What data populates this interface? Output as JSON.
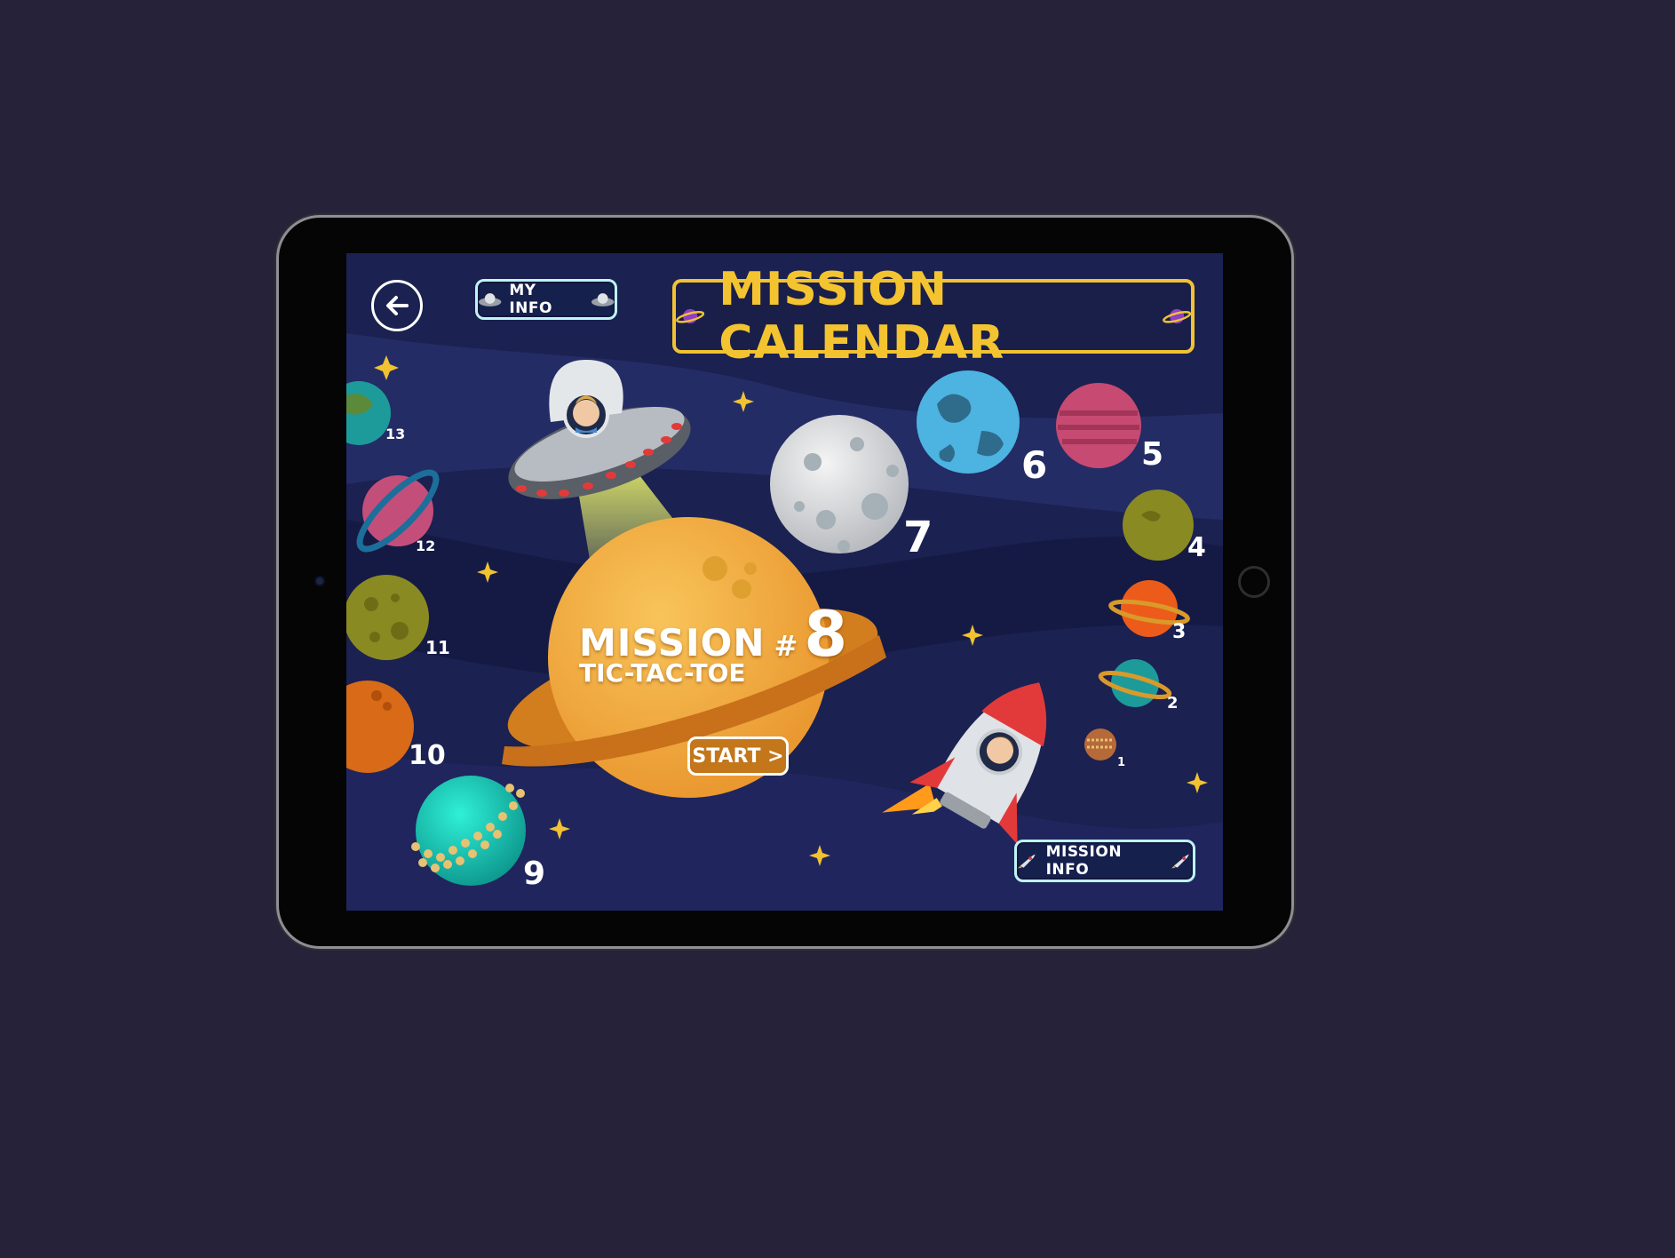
{
  "header": {
    "back_icon": "arrow-left-icon",
    "my_info_label": "MY INFO",
    "title": "MISSION CALENDAR"
  },
  "current_mission": {
    "label": "MISSION",
    "hash": "#",
    "number": "8",
    "name": "TIC-TAC-TOE",
    "start_label": "START >"
  },
  "mission_info_label": "MISSION INFO",
  "planets": [
    {
      "number": "1"
    },
    {
      "number": "2"
    },
    {
      "number": "3"
    },
    {
      "number": "4"
    },
    {
      "number": "5"
    },
    {
      "number": "6"
    },
    {
      "number": "7"
    },
    {
      "number": "9"
    },
    {
      "number": "10"
    },
    {
      "number": "11"
    },
    {
      "number": "12"
    },
    {
      "number": "13"
    }
  ],
  "colors": {
    "page_background": "#25223a",
    "screen_background": "#1b2150",
    "accent_gold": "#f4c430",
    "button_border": "#bff3f6",
    "current_planet": "#f2a93b",
    "start_button": "#c3761a"
  }
}
